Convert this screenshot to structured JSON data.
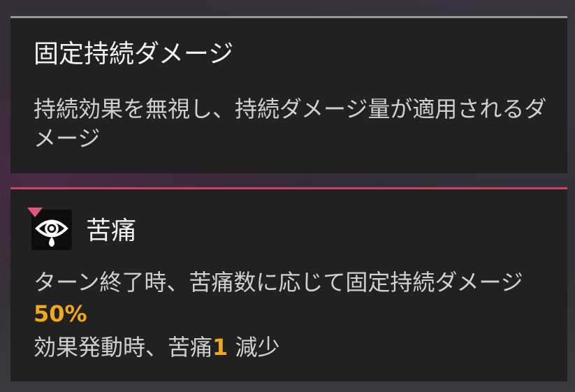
{
  "tooltip_top": {
    "title": "固定持続ダメージ",
    "description": "持続効果を無視し、持続ダメージ量が適用されるダメージ"
  },
  "tooltip_bottom": {
    "icon": "weeping-eye-icon",
    "name": "苦痛",
    "effect_text": "ターン終了時、苦痛数に応じて固定持続ダメージ",
    "effect_value": "50%",
    "trigger_text": "効果発動時、苦痛",
    "trigger_value": "1",
    "trigger_suffix": " 減少"
  },
  "colors": {
    "accent_debuff": "#c8475f",
    "highlight": "#f0a91c",
    "panel_bg": "#212121"
  }
}
